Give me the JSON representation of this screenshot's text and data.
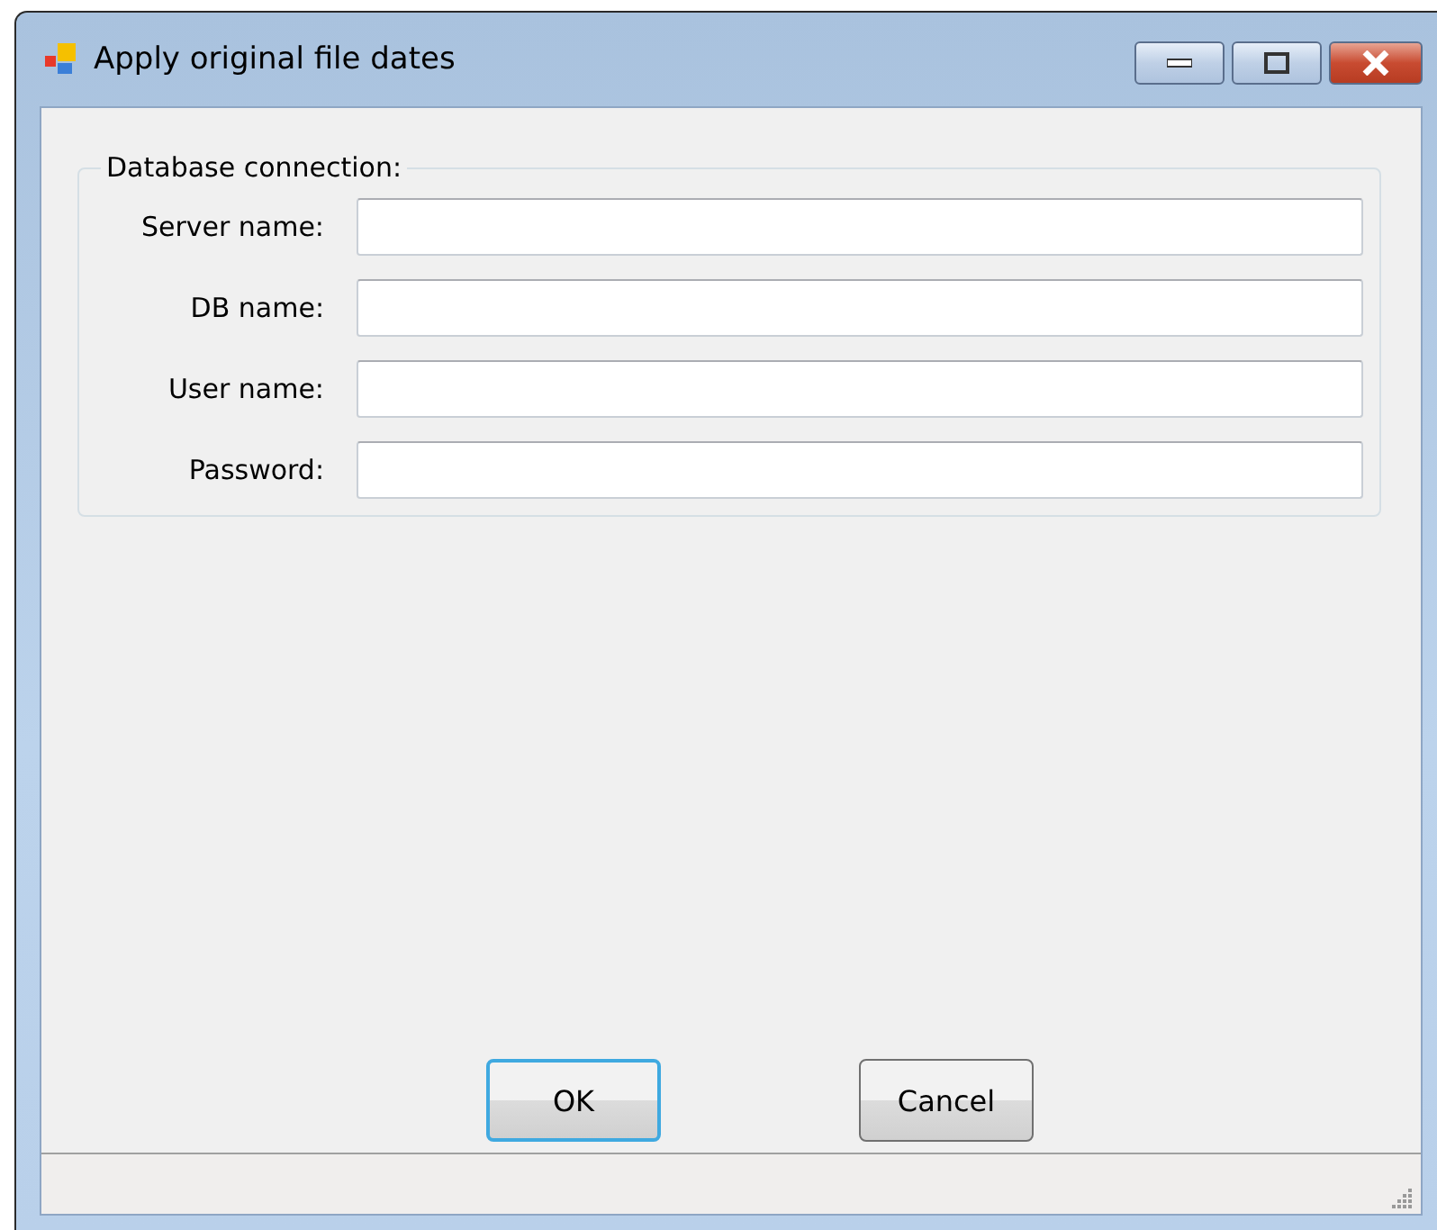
{
  "window": {
    "title": "Apply original file dates"
  },
  "group": {
    "title": "Database connection:",
    "fields": [
      {
        "label": "Server name:"
      },
      {
        "label": "DB name:"
      },
      {
        "label": "User name:"
      },
      {
        "label": "Password:"
      }
    ]
  },
  "buttons": [
    {
      "label": "OK",
      "focused": true
    },
    {
      "label": "Cancel",
      "focused": false
    }
  ]
}
